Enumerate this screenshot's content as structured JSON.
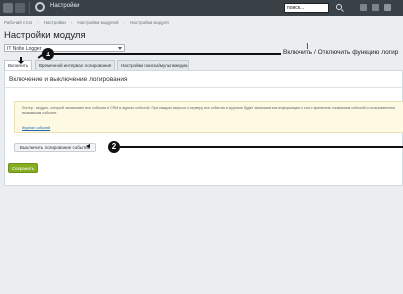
{
  "topbar": {
    "title": "Настройки",
    "search_value": "поиск..."
  },
  "breadcrumb": {
    "items": [
      "Рабочий стол",
      "Настройки",
      "Настройки модулей",
      "Настройки модуля"
    ]
  },
  "page": {
    "title": "Настройки модуля",
    "star": "☆"
  },
  "module_select": {
    "value": "IT Nolte Logger"
  },
  "tabs": [
    {
      "label": "Включить",
      "active": true
    },
    {
      "label": "Временной интервал логирования",
      "active": false
    },
    {
      "label": "Настройки поиска/мультимедиа",
      "active": false
    }
  ],
  "section": {
    "title": "Включение и выключение логирования"
  },
  "note": {
    "text": "Логгер - модуль, который записывает все события в CRM в журнал событий. При каждом запросе к серверу все события в журнале будет записываться информация о том с временем, названием событий и пользователем, вызвавшим событие.",
    "link": "Журнал событий"
  },
  "toggle_button": {
    "label": "Выключить логирование событий"
  },
  "save_button": {
    "label": "Сохранить"
  },
  "annotations": {
    "marker1": "1",
    "marker2": "2",
    "text1": "Включить / Отключить функцию логир"
  },
  "colors": {
    "topbar": "#3a4147",
    "save": "#86ad1f",
    "note_bg": "#fdf9e3",
    "link": "#2067b0"
  }
}
